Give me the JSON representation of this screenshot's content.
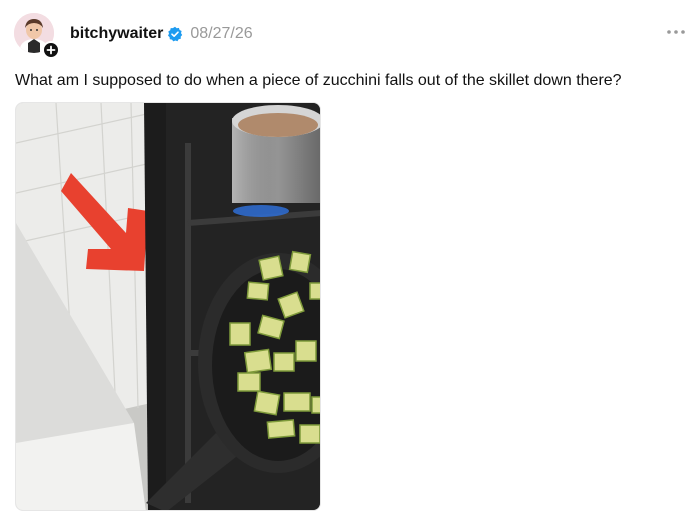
{
  "post": {
    "username": "bitchywaiter",
    "verified": true,
    "timestamp": "08/27/26",
    "text": "What am I supposed to do when a piece of zucchini falls out of the skillet down there?",
    "avatar_icon": "user-avatar",
    "badge_icon": "follow-plus-icon",
    "more_icon": "more-options-icon",
    "image": {
      "description_icon": "photo",
      "subject": "stove with skillet of zucchini and pot, red arrow pointing to gap between stove and counter"
    }
  },
  "colors": {
    "verified_blue": "#1d9bf0",
    "timestamp_gray": "#999999",
    "arrow_red": "#e8412f"
  }
}
